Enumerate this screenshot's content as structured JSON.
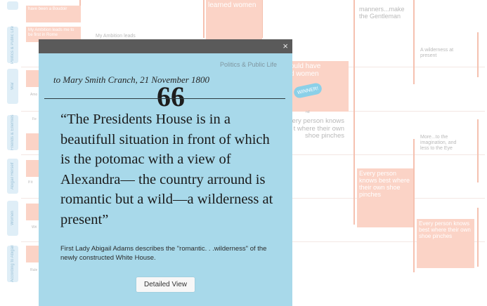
{
  "background": {
    "side_labels": [
      "Politics & Public Life",
      "War",
      "Friends & Enemies",
      "Abigail Herself",
      "Women",
      "According to Abigail"
    ],
    "boxes": {
      "b1": "have been a Boudoir",
      "b2": "My Ambition leads me to be first in Rome",
      "b3": "learned women",
      "b4": "ould have\nd women",
      "b5": "Every person knows best where their own shoe pinches",
      "b6": "Every person knows best where their own shoe pinches"
    },
    "texts": {
      "t1": "My Ambition leads",
      "t2": "manners...make\nthe Gentleman",
      "t3": "A wilderness at\npresent",
      "t4": "ery person knows\nt where their own\nshoe pinches",
      "t5": "More...to the\nimagination, and\nless to the Eye",
      "t6": "Amo",
      "t7": "Fe",
      "t8": "If it",
      "t9": "Wri",
      "t10": "Rule",
      "t11": "nd"
    },
    "winner_badge": "WINNER!"
  },
  "panel": {
    "category": "Politics & Public Life",
    "citation": "to Mary Smith Cranch, 21 November 1800",
    "quote_mark": "66",
    "quote": "“The Presidents House is in a beautifull situation in front of which is the potomac with a view of Alexandra— the country arround is romantic but a wild—a wilderness at present”",
    "description": "First Lady Abigail Adams describes the \"romantic. . .wilderness\" of the newly constructed White House.",
    "button_label": "Detailed View",
    "close_glyph": "×"
  },
  "colors": {
    "panel_bg": "#a8d9ea",
    "panel_bar": "#5a5a5a",
    "accent_box": "#fbd3c6",
    "side_strip": "#dfeef7"
  }
}
